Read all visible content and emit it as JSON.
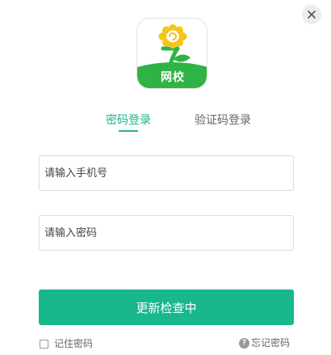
{
  "window": {
    "close_icon": "close-icon"
  },
  "logo": {
    "icon": "sunflower-icon",
    "text": "网校"
  },
  "tabs": {
    "password": {
      "label": "密码登录",
      "active": true
    },
    "sms": {
      "label": "验证码登录",
      "active": false
    }
  },
  "form": {
    "phone_placeholder": "请输入手机号",
    "phone_value": "",
    "password_placeholder": "请输入密码",
    "password_value": ""
  },
  "primary_button": {
    "label": "更新检查中"
  },
  "footer": {
    "remember_label": "记住密码",
    "remember_checked": false,
    "forgot_icon": "help-icon",
    "forgot_label": "忘记密码"
  },
  "colors": {
    "accent": "#18b78c",
    "logo_petal": "#f5c518",
    "logo_leaf": "#2fb344"
  }
}
